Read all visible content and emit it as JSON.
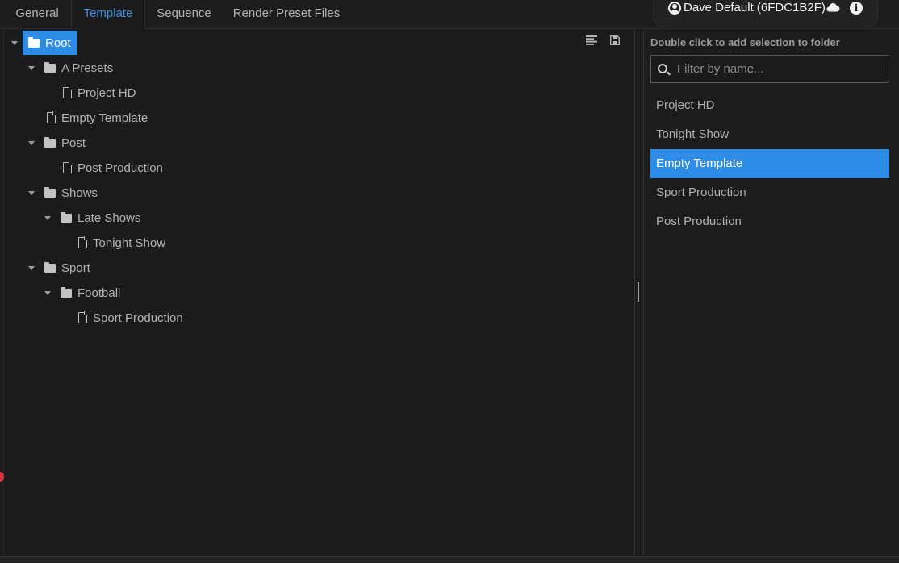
{
  "tabs": [
    {
      "label": "General"
    },
    {
      "label": "Template"
    },
    {
      "label": "Sequence"
    },
    {
      "label": "Render Preset Files"
    }
  ],
  "active_tab": "Template",
  "user": {
    "name": "Dave Default (6FDC1B2F)"
  },
  "icons": {
    "user": "user-circle-icon",
    "cloud": "cloud-icon",
    "info": "info-icon",
    "align": "align-left-icon",
    "save": "save-icon",
    "search": "search-icon",
    "folder": "folder-icon",
    "file": "file-icon"
  },
  "colors": {
    "accent": "#2d8ce6",
    "tab_active": "#3b8fe2",
    "background": "#1c1c1c"
  },
  "tree": {
    "rows": [
      {
        "label": "Root",
        "type": "folder",
        "expanded": true,
        "selected": true
      },
      {
        "label": "A Presets",
        "type": "folder",
        "expanded": true
      },
      {
        "label": "Project HD",
        "type": "file"
      },
      {
        "label": "Empty Template",
        "type": "file"
      },
      {
        "label": "Post",
        "type": "folder",
        "expanded": true
      },
      {
        "label": "Post Production",
        "type": "file"
      },
      {
        "label": "Shows",
        "type": "folder",
        "expanded": true
      },
      {
        "label": "Late Shows",
        "type": "folder",
        "expanded": true
      },
      {
        "label": "Tonight Show",
        "type": "file"
      },
      {
        "label": "Sport",
        "type": "folder",
        "expanded": true
      },
      {
        "label": "Football",
        "type": "folder",
        "expanded": true
      },
      {
        "label": "Sport Production",
        "type": "file"
      }
    ]
  },
  "right_panel": {
    "hint": "Double click to add selection to folder",
    "filter_placeholder": "Filter by name...",
    "filter_value": "",
    "items": [
      {
        "label": "Project HD"
      },
      {
        "label": "Tonight Show"
      },
      {
        "label": "Empty Template",
        "selected": true
      },
      {
        "label": "Sport Production"
      },
      {
        "label": "Post Production"
      }
    ]
  }
}
